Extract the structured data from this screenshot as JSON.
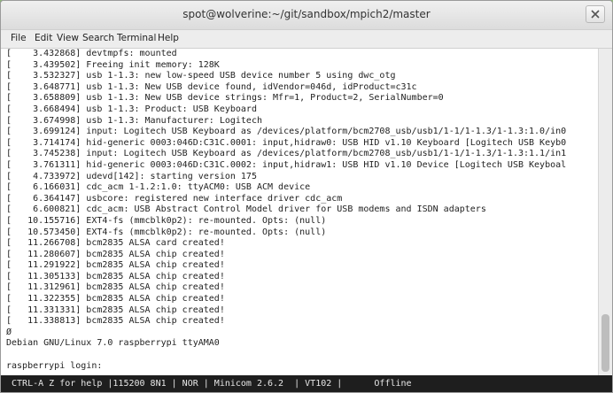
{
  "window": {
    "title": "spot@wolverine:~/git/sandbox/mpich2/master"
  },
  "menu": {
    "items": [
      "File",
      "Edit",
      "View",
      "Search",
      "Terminal",
      "Help"
    ]
  },
  "terminal": {
    "lines": [
      "[    3.432868] devtmpfs: mounted",
      "[    3.439502] Freeing init memory: 128K",
      "[    3.532327] usb 1-1.3: new low-speed USB device number 5 using dwc_otg",
      "[    3.648771] usb 1-1.3: New USB device found, idVendor=046d, idProduct=c31c",
      "[    3.658809] usb 1-1.3: New USB device strings: Mfr=1, Product=2, SerialNumber=0",
      "[    3.668494] usb 1-1.3: Product: USB Keyboard",
      "[    3.674998] usb 1-1.3: Manufacturer: Logitech",
      "[    3.699124] input: Logitech USB Keyboard as /devices/platform/bcm2708_usb/usb1/1-1/1-1.3/1-1.3:1.0/in0",
      "[    3.714174] hid-generic 0003:046D:C31C.0001: input,hidraw0: USB HID v1.10 Keyboard [Logitech USB Keyb0",
      "[    3.745238] input: Logitech USB Keyboard as /devices/platform/bcm2708_usb/usb1/1-1/1-1.3/1-1.3:1.1/in1",
      "[    3.761311] hid-generic 0003:046D:C31C.0002: input,hidraw1: USB HID v1.10 Device [Logitech USB Keyboal",
      "[    4.733972] udevd[142]: starting version 175",
      "[    6.166031] cdc_acm 1-1.2:1.0: ttyACM0: USB ACM device",
      "[    6.364147] usbcore: registered new interface driver cdc_acm",
      "[    6.600821] cdc_acm: USB Abstract Control Model driver for USB modems and ISDN adapters",
      "[   10.155716] EXT4-fs (mmcblk0p2): re-mounted. Opts: (null)",
      "[   10.573450] EXT4-fs (mmcblk0p2): re-mounted. Opts: (null)",
      "[   11.266708] bcm2835 ALSA card created!",
      "[   11.280607] bcm2835 ALSA chip created!",
      "[   11.291922] bcm2835 ALSA chip created!",
      "[   11.305133] bcm2835 ALSA chip created!",
      "[   11.312961] bcm2835 ALSA chip created!",
      "[   11.322355] bcm2835 ALSA chip created!",
      "[   11.331331] bcm2835 ALSA chip created!",
      "[   11.338813] bcm2835 ALSA chip created!",
      "Ø",
      "Debian GNU/Linux 7.0 raspberrypi ttyAMA0",
      "",
      "raspberrypi login: "
    ]
  },
  "statusbar": {
    "text": " CTRL-A Z for help |115200 8N1 | NOR | Minicom 2.6.2  | VT102 |      Offline"
  },
  "icons": {
    "close": "close-icon"
  },
  "colors": {
    "status_bg": "#1e1e1e",
    "status_fg": "#e6e6e6",
    "terminal_bg": "#ffffff",
    "terminal_fg": "#222222"
  }
}
